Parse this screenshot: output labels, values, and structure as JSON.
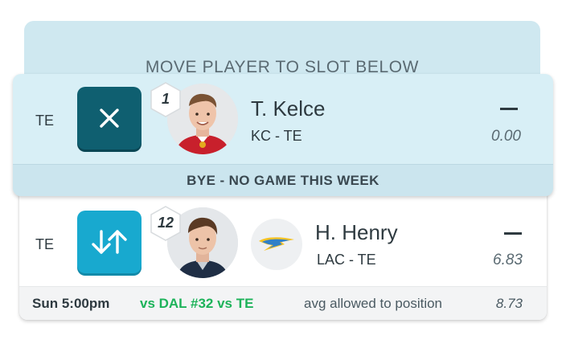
{
  "header": {
    "title": "MOVE PLAYER TO SLOT BELOW"
  },
  "moving_player": {
    "position": "TE",
    "action_icon": "close-icon",
    "rank": "1",
    "name": "T. Kelce",
    "team_pos": "KC - TE",
    "projection": "—",
    "score": "0.00",
    "status": "BYE - NO GAME THIS WEEK"
  },
  "target_slot": {
    "position": "TE",
    "action_icon": "swap-arrows-icon",
    "rank": "12",
    "name": "H. Henry",
    "team_pos": "LAC - TE",
    "team_logo": "chargers-bolt-logo",
    "projection": "—",
    "score": "6.83",
    "matchup": {
      "time": "Sun 5:00pm",
      "opponent": "vs DAL #32 vs TE",
      "stat_label": "avg allowed to position",
      "stat_value": "8.73"
    }
  },
  "colors": {
    "remove_button": "#0f5f70",
    "swap_button": "#18a9cf",
    "matchup_green": "#1db35a",
    "header_bg": "#cfe8f0",
    "selected_bg": "#d8eff6"
  }
}
